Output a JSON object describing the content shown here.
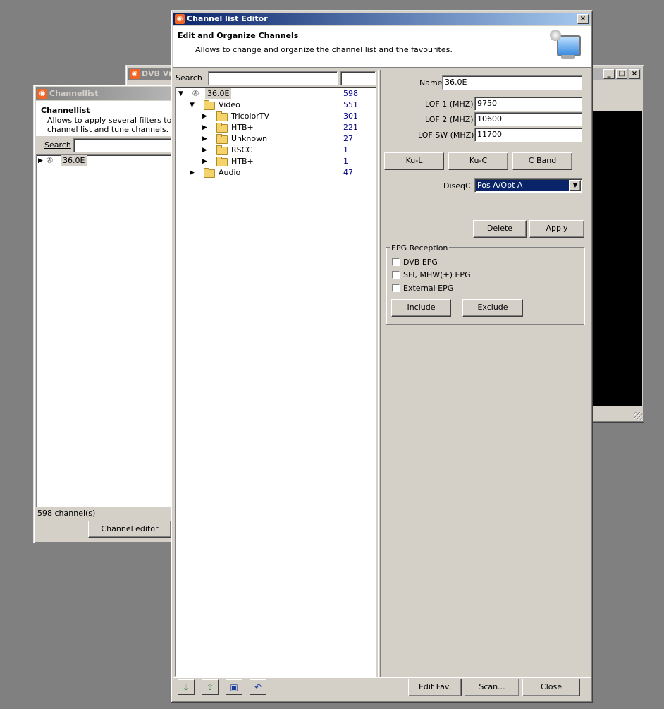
{
  "dvb_window": {
    "title": "DVB Vie",
    "min": "_",
    "max": "□",
    "close": "×"
  },
  "channellist_window": {
    "title": "Channellist",
    "header_title": "Channellist",
    "header_desc_line1": "Allows to apply several filters to the",
    "header_desc_line2": "channel list and tune channels.",
    "search_label": "Search",
    "search_value": "",
    "tree_root_label": "36.0E",
    "status": "598 channel(s)",
    "channel_editor_button": "Channel editor"
  },
  "editor_window": {
    "title": "Channel list Editor",
    "close": "×",
    "header_title": "Edit and Organize Channels",
    "header_desc": "Allows to change and organize the channel list and the favourites.",
    "search_label": "Search",
    "search_value": "",
    "search_value2": "",
    "tree": [
      {
        "label": "36.0E",
        "count": "598"
      },
      {
        "label": "Video",
        "count": "551"
      },
      {
        "label": "TricolorTV",
        "count": "301"
      },
      {
        "label": "НТВ+",
        "count": "221"
      },
      {
        "label": "Unknown",
        "count": "27"
      },
      {
        "label": "RSCC",
        "count": "1"
      },
      {
        "label": "НТВ+",
        "count": "1"
      },
      {
        "label": "Audio",
        "count": "47"
      }
    ],
    "name_label": "Name",
    "name_value": "36.0E",
    "lof1_label": "LOF 1 (MHZ)",
    "lof1_value": "9750",
    "lof2_label": "LOF 2 (MHZ)",
    "lof2_value": "10600",
    "lofsw_label": "LOF SW (MHZ)",
    "lofsw_value": "11700",
    "band_buttons": [
      "Ku-L",
      "Ku-C",
      "C Band"
    ],
    "diseqc_label": "DiseqC",
    "diseqc_value": "Pos A/Opt A",
    "delete_button": "Delete",
    "apply_button": "Apply",
    "epg_group_label": "EPG Reception",
    "epg_options": [
      "DVB EPG",
      "SFI, MHW(+) EPG",
      "External EPG"
    ],
    "include_button": "Include",
    "exclude_button": "Exclude",
    "edit_fav_button": "Edit Fav.",
    "scan_button": "Scan...",
    "close_button": "Close"
  }
}
